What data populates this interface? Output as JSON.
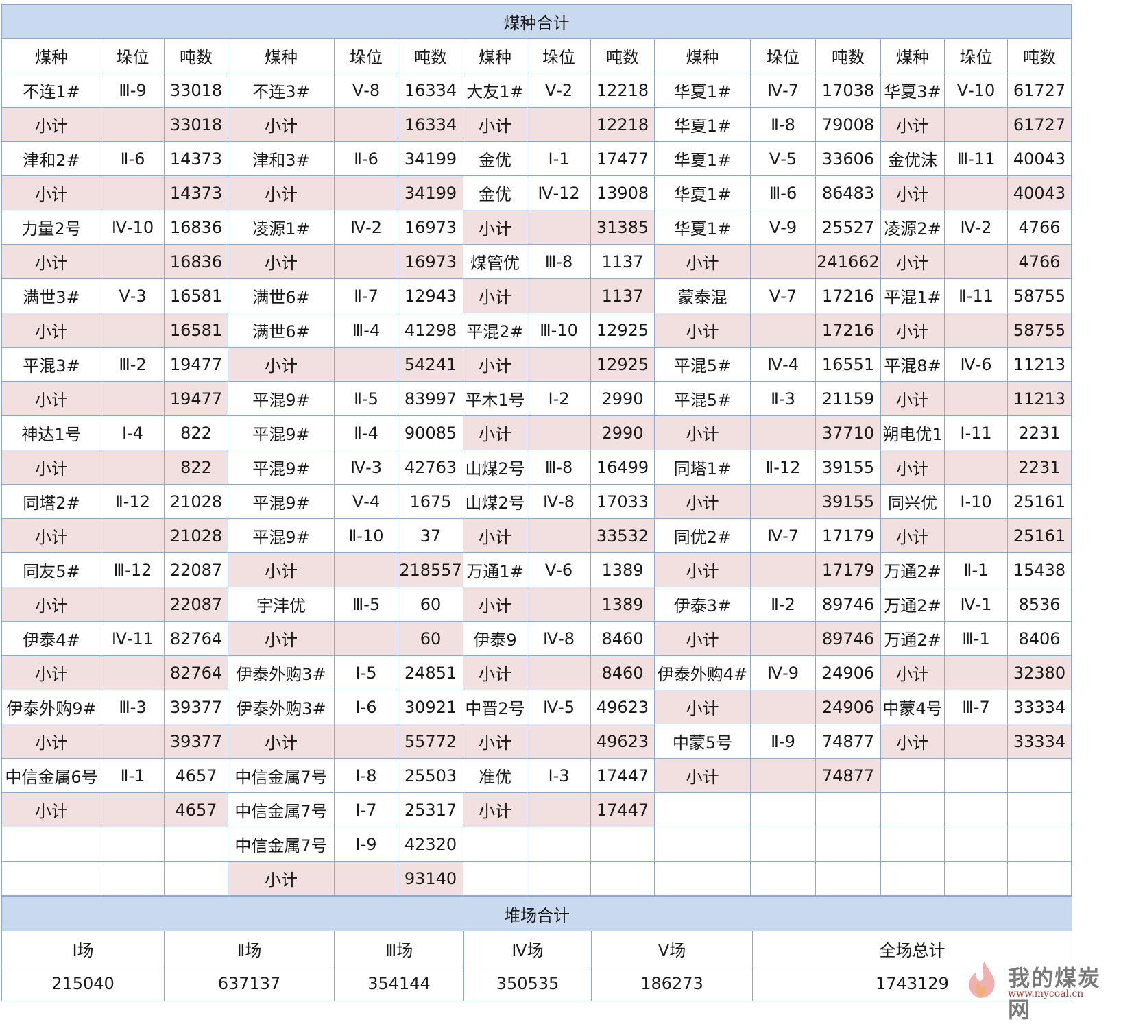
{
  "colors": {
    "header_bg": "#c9daf0",
    "subtotal_bg": "#f2dfe0",
    "border": "#8ea8cf"
  },
  "coal_section": {
    "title": "煤种合计",
    "headers": [
      "煤种",
      "垛位",
      "吨数",
      "煤种",
      "垛位",
      "吨数",
      "煤种",
      "垛位",
      "吨数",
      "煤种",
      "垛位",
      "吨数",
      "煤种",
      "垛位",
      "吨数"
    ],
    "rows": [
      [
        [
          "不连1#",
          "Ⅲ-9",
          "33018"
        ],
        [
          "不连3#",
          "Ⅴ-8",
          "16334"
        ],
        [
          "大友1#",
          "Ⅴ-2",
          "12218"
        ],
        [
          "华夏1#",
          "Ⅳ-7",
          "17038"
        ],
        [
          "华夏3#",
          "Ⅴ-10",
          "61727"
        ]
      ],
      [
        [
          "小计",
          "",
          "33018"
        ],
        [
          "小计",
          "",
          "16334"
        ],
        [
          "小计",
          "",
          "12218"
        ],
        [
          "华夏1#",
          "Ⅱ-8",
          "79008"
        ],
        [
          "小计",
          "",
          "61727"
        ]
      ],
      [
        [
          "津和2#",
          "Ⅱ-6",
          "14373"
        ],
        [
          "津和3#",
          "Ⅱ-6",
          "34199"
        ],
        [
          "金优",
          "Ⅰ-1",
          "17477"
        ],
        [
          "华夏1#",
          "Ⅴ-5",
          "33606"
        ],
        [
          "金优沫",
          "Ⅲ-11",
          "40043"
        ]
      ],
      [
        [
          "小计",
          "",
          "14373"
        ],
        [
          "小计",
          "",
          "34199"
        ],
        [
          "金优",
          "Ⅳ-12",
          "13908"
        ],
        [
          "华夏1#",
          "Ⅲ-6",
          "86483"
        ],
        [
          "小计",
          "",
          "40043"
        ]
      ],
      [
        [
          "力量2号",
          "Ⅳ-10",
          "16836"
        ],
        [
          "凌源1#",
          "Ⅳ-2",
          "16973"
        ],
        [
          "小计",
          "",
          "31385"
        ],
        [
          "华夏1#",
          "Ⅴ-9",
          "25527"
        ],
        [
          "凌源2#",
          "Ⅳ-2",
          "4766"
        ]
      ],
      [
        [
          "小计",
          "",
          "16836"
        ],
        [
          "小计",
          "",
          "16973"
        ],
        [
          "煤管优",
          "Ⅲ-8",
          "1137"
        ],
        [
          "小计",
          "",
          "241662"
        ],
        [
          "小计",
          "",
          "4766"
        ]
      ],
      [
        [
          "满世3#",
          "Ⅴ-3",
          "16581"
        ],
        [
          "满世6#",
          "Ⅱ-7",
          "12943"
        ],
        [
          "小计",
          "",
          "1137"
        ],
        [
          "蒙泰混",
          "Ⅴ-7",
          "17216"
        ],
        [
          "平混1#",
          "Ⅱ-11",
          "58755"
        ]
      ],
      [
        [
          "小计",
          "",
          "16581"
        ],
        [
          "满世6#",
          "Ⅲ-4",
          "41298"
        ],
        [
          "平混2#",
          "Ⅲ-10",
          "12925"
        ],
        [
          "小计",
          "",
          "17216"
        ],
        [
          "小计",
          "",
          "58755"
        ]
      ],
      [
        [
          "平混3#",
          "Ⅲ-2",
          "19477"
        ],
        [
          "小计",
          "",
          "54241"
        ],
        [
          "小计",
          "",
          "12925"
        ],
        [
          "平混5#",
          "Ⅳ-4",
          "16551"
        ],
        [
          "平混8#",
          "Ⅳ-6",
          "11213"
        ]
      ],
      [
        [
          "小计",
          "",
          "19477"
        ],
        [
          "平混9#",
          "Ⅱ-5",
          "83997"
        ],
        [
          "平木1号",
          "Ⅰ-2",
          "2990"
        ],
        [
          "平混5#",
          "Ⅱ-3",
          "21159"
        ],
        [
          "小计",
          "",
          "11213"
        ]
      ],
      [
        [
          "神达1号",
          "Ⅰ-4",
          "822"
        ],
        [
          "平混9#",
          "Ⅱ-4",
          "90085"
        ],
        [
          "小计",
          "",
          "2990"
        ],
        [
          "小计",
          "",
          "37710"
        ],
        [
          "朔电优1",
          "Ⅰ-11",
          "2231"
        ]
      ],
      [
        [
          "小计",
          "",
          "822"
        ],
        [
          "平混9#",
          "Ⅳ-3",
          "42763"
        ],
        [
          "山煤2号",
          "Ⅲ-8",
          "16499"
        ],
        [
          "同塔1#",
          "Ⅱ-12",
          "39155"
        ],
        [
          "小计",
          "",
          "2231"
        ]
      ],
      [
        [
          "同塔2#",
          "Ⅱ-12",
          "21028"
        ],
        [
          "平混9#",
          "Ⅴ-4",
          "1675"
        ],
        [
          "山煤2号",
          "Ⅳ-8",
          "17033"
        ],
        [
          "小计",
          "",
          "39155"
        ],
        [
          "同兴优",
          "Ⅰ-10",
          "25161"
        ]
      ],
      [
        [
          "小计",
          "",
          "21028"
        ],
        [
          "平混9#",
          "Ⅱ-10",
          "37"
        ],
        [
          "小计",
          "",
          "33532"
        ],
        [
          "同优2#",
          "Ⅳ-7",
          "17179"
        ],
        [
          "小计",
          "",
          "25161"
        ]
      ],
      [
        [
          "同友5#",
          "Ⅲ-12",
          "22087"
        ],
        [
          "小计",
          "",
          "218557"
        ],
        [
          "万通1#",
          "Ⅴ-6",
          "1389"
        ],
        [
          "小计",
          "",
          "17179"
        ],
        [
          "万通2#",
          "Ⅱ-1",
          "15438"
        ]
      ],
      [
        [
          "小计",
          "",
          "22087"
        ],
        [
          "宇沣优",
          "Ⅲ-5",
          "60"
        ],
        [
          "小计",
          "",
          "1389"
        ],
        [
          "伊泰3#",
          "Ⅱ-2",
          "89746"
        ],
        [
          "万通2#",
          "Ⅳ-1",
          "8536"
        ]
      ],
      [
        [
          "伊泰4#",
          "Ⅳ-11",
          "82764"
        ],
        [
          "小计",
          "",
          "60"
        ],
        [
          "伊泰9",
          "Ⅳ-8",
          "8460"
        ],
        [
          "小计",
          "",
          "89746"
        ],
        [
          "万通2#",
          "Ⅲ-1",
          "8406"
        ]
      ],
      [
        [
          "小计",
          "",
          "82764"
        ],
        [
          "伊泰外购3#",
          "Ⅰ-5",
          "24851"
        ],
        [
          "小计",
          "",
          "8460"
        ],
        [
          "伊泰外购4#",
          "Ⅳ-9",
          "24906"
        ],
        [
          "小计",
          "",
          "32380"
        ]
      ],
      [
        [
          "伊泰外购9#",
          "Ⅲ-3",
          "39377"
        ],
        [
          "伊泰外购3#",
          "Ⅰ-6",
          "30921"
        ],
        [
          "中晋2号",
          "Ⅳ-5",
          "49623"
        ],
        [
          "小计",
          "",
          "24906"
        ],
        [
          "中蒙4号",
          "Ⅲ-7",
          "33334"
        ]
      ],
      [
        [
          "小计",
          "",
          "39377"
        ],
        [
          "小计",
          "",
          "55772"
        ],
        [
          "小计",
          "",
          "49623"
        ],
        [
          "中蒙5号",
          "Ⅱ-9",
          "74877"
        ],
        [
          "小计",
          "",
          "33334"
        ]
      ],
      [
        [
          "中信金属6号",
          "Ⅱ-1",
          "4657"
        ],
        [
          "中信金属7号",
          "Ⅰ-8",
          "25503"
        ],
        [
          "准优",
          "Ⅰ-3",
          "17447"
        ],
        [
          "小计",
          "",
          "74877"
        ],
        null
      ],
      [
        [
          "小计",
          "",
          "4657"
        ],
        [
          "中信金属7号",
          "Ⅰ-7",
          "25317"
        ],
        [
          "小计",
          "",
          "17447"
        ],
        null,
        null
      ],
      [
        null,
        [
          "中信金属7号",
          "Ⅰ-9",
          "42320"
        ],
        null,
        null,
        null
      ],
      [
        null,
        [
          "小计",
          "",
          "93140"
        ],
        null,
        null,
        null
      ]
    ]
  },
  "yard_section": {
    "title": "堆场合计",
    "headers": [
      "Ⅰ场",
      "Ⅱ场",
      "Ⅲ场",
      "Ⅳ场",
      "Ⅴ场",
      "全场总计"
    ],
    "values": [
      "215040",
      "637137",
      "354144",
      "350535",
      "186273",
      "1743129"
    ]
  },
  "watermark": {
    "text": "我的煤炭网",
    "url": "www.mycoal.cn"
  }
}
